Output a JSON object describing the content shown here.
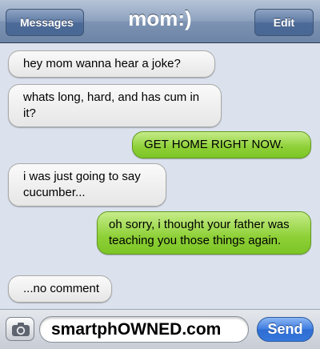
{
  "navbar": {
    "title": "mom:)",
    "back_label": "Messages",
    "edit_label": "Edit"
  },
  "messages": [
    {
      "direction": "in",
      "text": "hey mom wanna hear a joke?"
    },
    {
      "direction": "in",
      "text": "whats long, hard, and has cum in it?"
    },
    {
      "direction": "out",
      "text": "GET HOME RIGHT NOW."
    },
    {
      "direction": "in",
      "text": "i was just going to say cucumber..."
    },
    {
      "direction": "out",
      "text": "oh sorry, i thought your father was teaching you those things again."
    },
    {
      "direction": "in",
      "text": "...no comment"
    }
  ],
  "compose": {
    "input_value": "smartphOWNED.com",
    "send_label": "Send",
    "camera_icon": "camera-icon"
  },
  "colors": {
    "incoming_bubble": "#e9e9e9",
    "outgoing_bubble": "#8dd036",
    "navbar": "#7d93b3",
    "send_button": "#3678dc"
  }
}
